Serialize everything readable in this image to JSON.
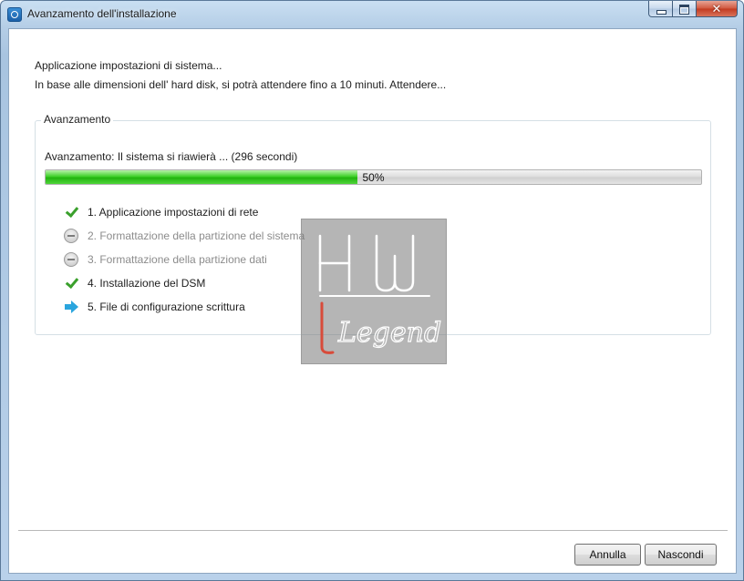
{
  "window": {
    "title": "Avanzamento dell'installazione",
    "controls": {
      "minimize": "minimize-icon",
      "maximize": "maximize-icon",
      "close": "close-icon",
      "close_glyph": "✕"
    }
  },
  "intro": {
    "line1": "Applicazione impostazioni di sistema...",
    "line2": "In base alle dimensioni dell' hard disk, si potrà attendere fino a 10 minuti. Attendere..."
  },
  "group": {
    "legend": "Avanzamento",
    "status": "Avanzamento: Il sistema si riawierà ... (296 secondi)",
    "progress": {
      "percent": 50,
      "label": "50%"
    }
  },
  "steps": [
    {
      "label": "1. Applicazione impostazioni di rete",
      "state": "done",
      "icon": "check-icon"
    },
    {
      "label": "2. Formattazione della partizione del sistema",
      "state": "pending",
      "icon": "pending-icon"
    },
    {
      "label": "3. Formattazione della partizione dati",
      "state": "pending",
      "icon": "pending-icon"
    },
    {
      "label": "4. Installazione del DSM",
      "state": "done",
      "icon": "check-icon"
    },
    {
      "label": "5. File di configurazione scrittura",
      "state": "current",
      "icon": "arrow-right-icon"
    }
  ],
  "buttons": {
    "cancel": "Annulla",
    "hide": "Nascondi"
  },
  "watermark": {
    "mark": "HW",
    "word": "Legend"
  },
  "colors": {
    "progress_green": "#22b40f",
    "check_green": "#3aa02c",
    "arrow_blue": "#2aa5de",
    "pending_text": "#8c8c8c",
    "watermark_letter": "#d84b3a"
  }
}
